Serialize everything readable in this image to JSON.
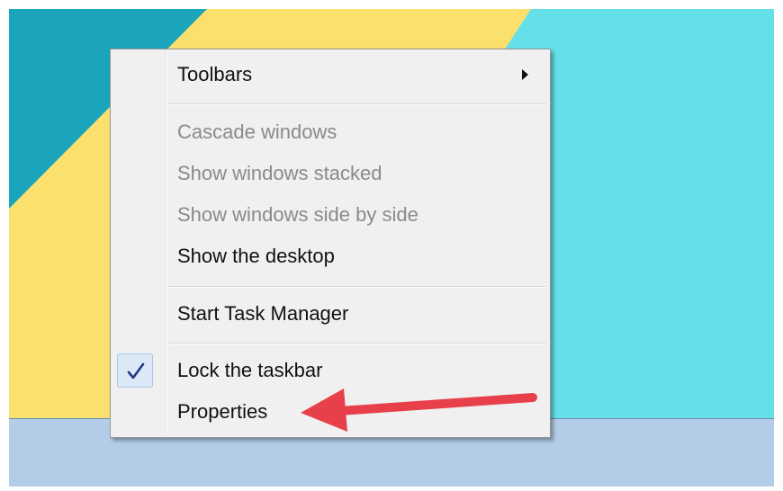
{
  "colors": {
    "wallpaper_teal": "#1ba5bd",
    "wallpaper_yellow": "#fbe06e",
    "wallpaper_cyan": "#65e0e8",
    "taskbar": "#b3cde9",
    "menu_bg": "#f0f0f0",
    "annotation_arrow": "#e8404a"
  },
  "context_menu": {
    "items": [
      {
        "label": "Toolbars",
        "enabled": true,
        "has_submenu": true,
        "submenu_icon": "chevron-right-icon"
      },
      {
        "label": "Cascade windows",
        "enabled": false
      },
      {
        "label": "Show windows stacked",
        "enabled": false
      },
      {
        "label": "Show windows side by side",
        "enabled": false
      },
      {
        "label": "Show the desktop",
        "enabled": true
      },
      {
        "label": "Start Task Manager",
        "enabled": true
      },
      {
        "label": "Lock the taskbar",
        "enabled": true,
        "checked": true,
        "check_icon": "checkmark-icon"
      },
      {
        "label": "Properties",
        "enabled": true
      }
    ]
  },
  "annotation": {
    "icon": "arrow-left-icon",
    "color": "#e8404a"
  }
}
